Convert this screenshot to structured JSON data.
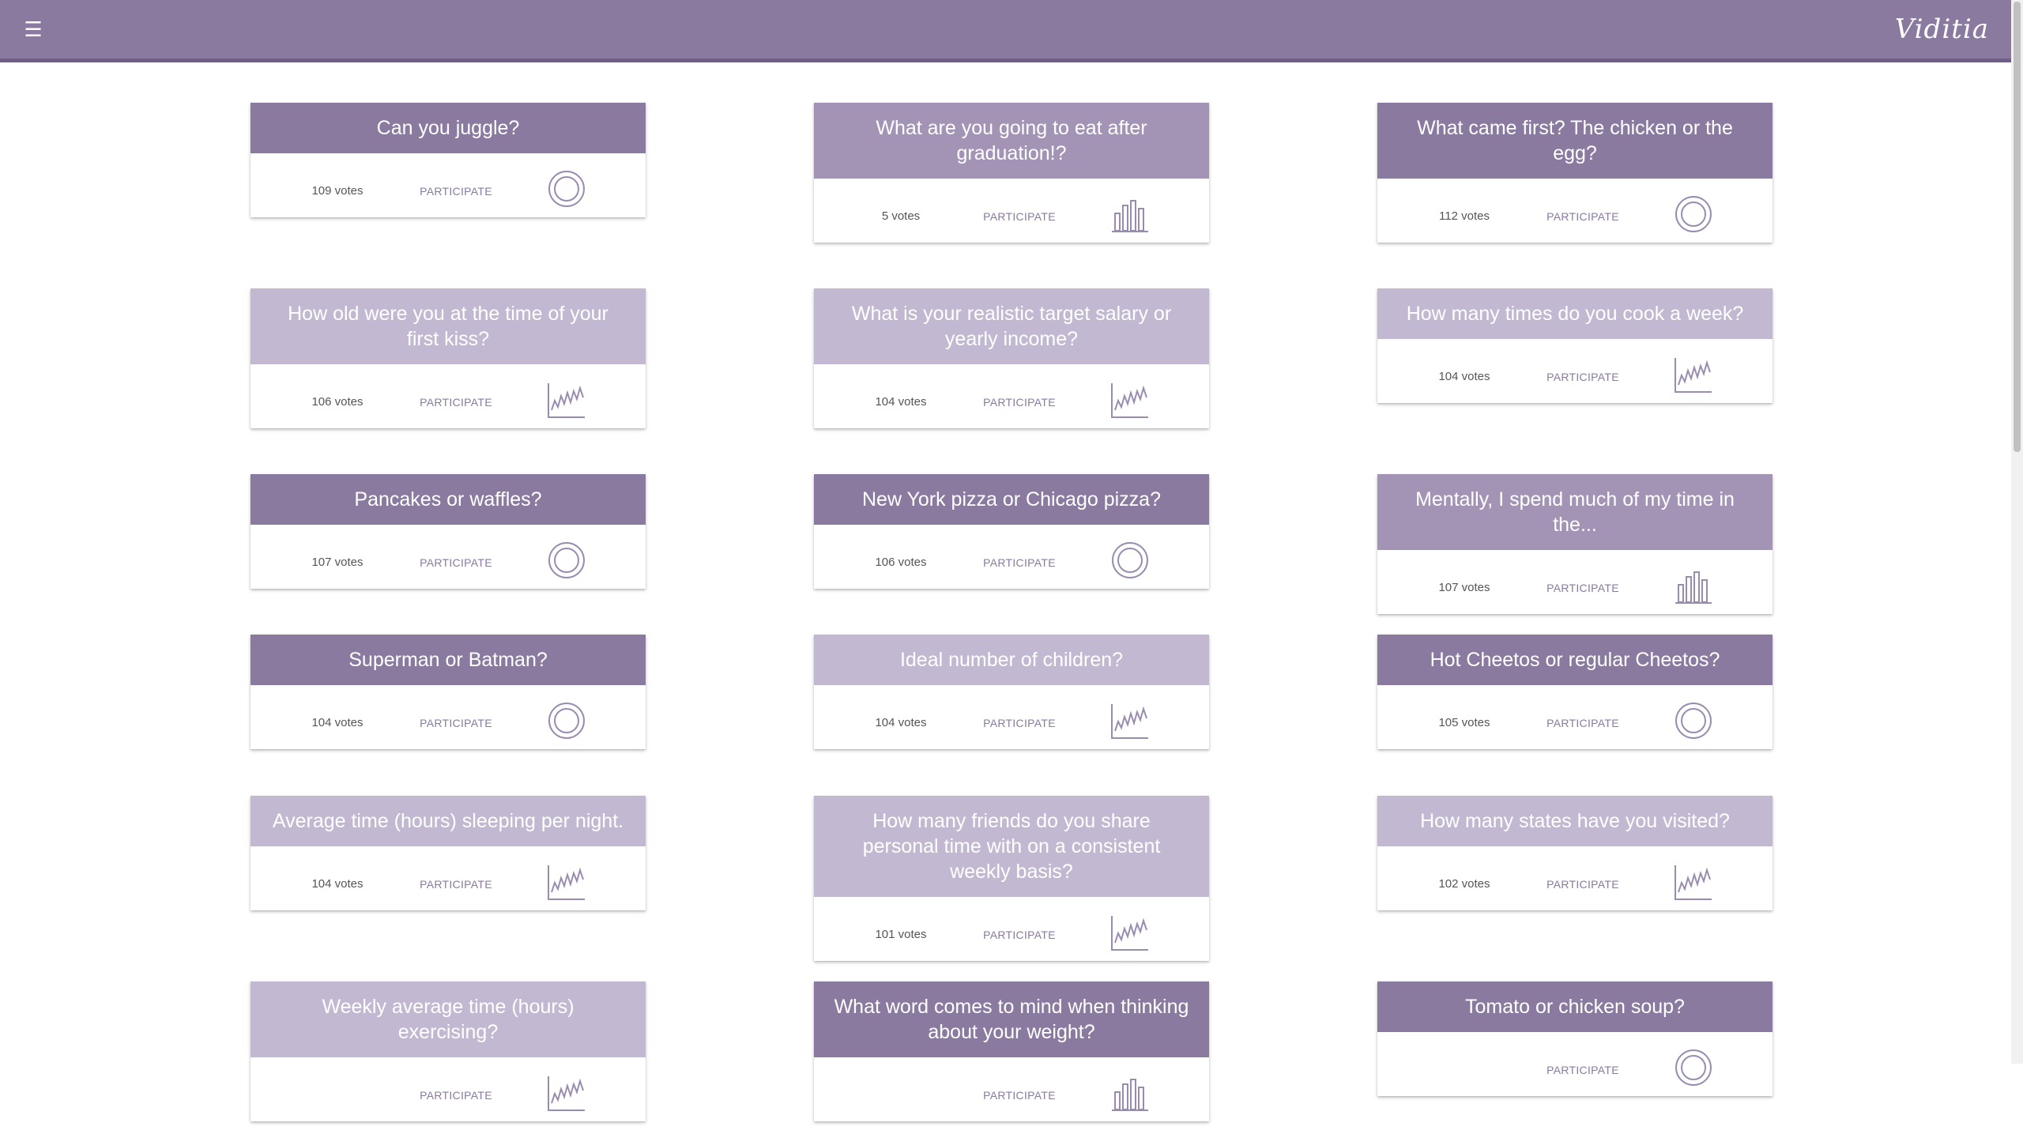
{
  "app": {
    "menu_icon": "hamburger-menu-icon",
    "logo_text": "Viditia"
  },
  "colors": {
    "primary": "#8a7aa0",
    "medium": "#a394b6",
    "light": "#c2b8d1",
    "header_dark": "#6f5f86"
  },
  "polls": [
    {
      "question": "Can you juggle?",
      "votes": "109 votes",
      "action": "PARTICIPATE",
      "chart_icon": "donut",
      "shade": "c1"
    },
    {
      "question": "What are you going to eat after graduation!?",
      "votes": "5 votes",
      "action": "PARTICIPATE",
      "chart_icon": "bar",
      "shade": "c2"
    },
    {
      "question": "What came first? The chicken or the egg?",
      "votes": "112 votes",
      "action": "PARTICIPATE",
      "chart_icon": "donut",
      "shade": "c1"
    },
    {
      "question": "How old were you at the time of your first kiss?",
      "votes": "106 votes",
      "action": "PARTICIPATE",
      "chart_icon": "line",
      "shade": "c3"
    },
    {
      "question": "What is your realistic target salary or yearly income?",
      "votes": "104 votes",
      "action": "PARTICIPATE",
      "chart_icon": "line",
      "shade": "c3"
    },
    {
      "question": "How many times do you cook a week?",
      "votes": "104 votes",
      "action": "PARTICIPATE",
      "chart_icon": "line",
      "shade": "c3"
    },
    {
      "question": "Pancakes or waffles?",
      "votes": "107 votes",
      "action": "PARTICIPATE",
      "chart_icon": "donut",
      "shade": "c1"
    },
    {
      "question": "New York pizza or Chicago pizza?",
      "votes": "106 votes",
      "action": "PARTICIPATE",
      "chart_icon": "donut",
      "shade": "c1"
    },
    {
      "question": "Mentally, I spend much of my time in the...",
      "votes": "107 votes",
      "action": "PARTICIPATE",
      "chart_icon": "bar",
      "shade": "c2"
    },
    {
      "question": "Superman or Batman?",
      "votes": "104 votes",
      "action": "PARTICIPATE",
      "chart_icon": "donut",
      "shade": "c1"
    },
    {
      "question": "Ideal number of children?",
      "votes": "104 votes",
      "action": "PARTICIPATE",
      "chart_icon": "line",
      "shade": "c3"
    },
    {
      "question": "Hot Cheetos or regular Cheetos?",
      "votes": "105 votes",
      "action": "PARTICIPATE",
      "chart_icon": "donut",
      "shade": "c1"
    },
    {
      "question": "Average time (hours) sleeping per night.",
      "votes": "104 votes",
      "action": "PARTICIPATE",
      "chart_icon": "line",
      "shade": "c3"
    },
    {
      "question": "How many friends do you share personal time with on a consistent weekly basis?",
      "votes": "101 votes",
      "action": "PARTICIPATE",
      "chart_icon": "line",
      "shade": "c3"
    },
    {
      "question": "How many states have you visited?",
      "votes": "102 votes",
      "action": "PARTICIPATE",
      "chart_icon": "line",
      "shade": "c3"
    },
    {
      "question": "Weekly average time (hours) exercising?",
      "votes": "",
      "action": "PARTICIPATE",
      "chart_icon": "line",
      "shade": "c3"
    },
    {
      "question": "What word comes to mind when thinking about your weight?",
      "votes": "",
      "action": "PARTICIPATE",
      "chart_icon": "bar",
      "shade": "c1"
    },
    {
      "question": "Tomato or chicken soup?",
      "votes": "",
      "action": "PARTICIPATE",
      "chart_icon": "donut",
      "shade": "c1"
    }
  ]
}
